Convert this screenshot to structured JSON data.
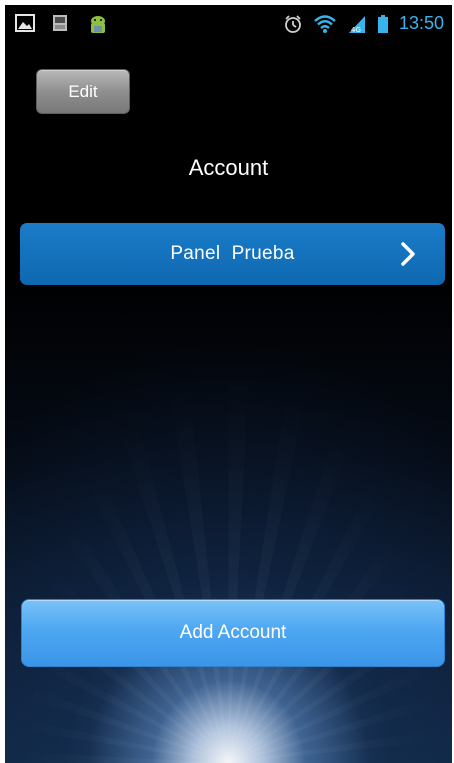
{
  "status_bar": {
    "time": "13:50",
    "notification_icons": [
      "image-icon",
      "sim-3g-icon",
      "android-icon"
    ],
    "system_icons": [
      "alarm-icon",
      "wifi-icon",
      "signal-icon",
      "battery-icon"
    ],
    "accent_color": "#39b3ee"
  },
  "toolbar": {
    "edit_label": "Edit"
  },
  "page": {
    "title": "Account"
  },
  "accounts": [
    {
      "label": "Panel  Prueba",
      "icon": "chevron-right-icon"
    }
  ],
  "actions": {
    "add_account_label": "Add Account"
  },
  "colors": {
    "account_row": "#0e68b0",
    "add_button": "#4ea7f1",
    "edit_button": "#8f8f8f"
  }
}
